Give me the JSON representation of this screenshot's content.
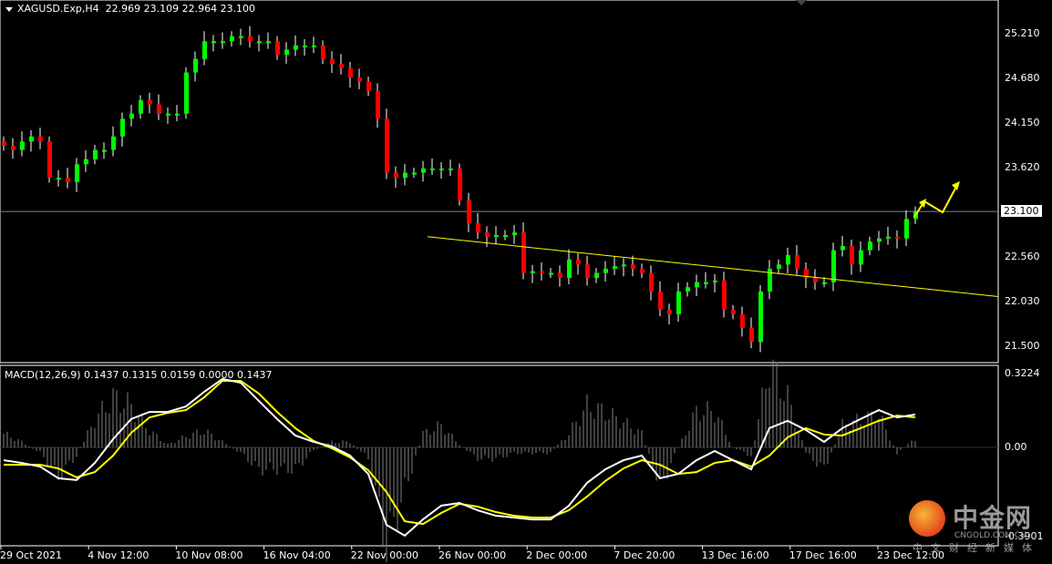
{
  "header": {
    "symbol": "XAGUSD.Exp,H4",
    "ohlc": "22.969 23.109 22.964 23.100"
  },
  "macd_header": "MACD(12,26,9) 0.1437 0.1315 0.0159 0.0000 0.1437",
  "watermark": {
    "name": "中金网",
    "domain": "CNGOLD.COM.CN",
    "slogan": "中文财经新媒体"
  },
  "colors": {
    "background": "#000000",
    "bull": "#00ff00",
    "bear": "#ff0000",
    "wick": "#ffffff",
    "macd_main": "#ffffff",
    "macd_signal": "#ffff00",
    "histogram": "#808080",
    "trendline": "#ffff00",
    "price_line": "#778899",
    "arrows": "#ffff00"
  },
  "chart_data": [
    {
      "type": "candlestick",
      "title": "XAGUSD.Exp,H4",
      "y_ticks": [
        "25.210",
        "24.680",
        "24.150",
        "23.620",
        "22.560",
        "22.030",
        "21.500"
      ],
      "current_price": "23.100",
      "ylim": [
        21.45,
        25.6
      ],
      "x_ticks": [
        "29 Oct 2021",
        "4 Nov 12:00",
        "10 Nov 08:00",
        "16 Nov 04:00",
        "22 Nov 00:00",
        "26 Nov 00:00",
        "2 Dec 00:00",
        "7 Dec 20:00",
        "13 Dec 16:00",
        "17 Dec 16:00",
        "23 Dec 12:00"
      ],
      "close": [
        23.88,
        23.83,
        23.93,
        23.99,
        23.93,
        23.5,
        23.5,
        23.45,
        23.66,
        23.72,
        23.83,
        23.83,
        23.99,
        24.2,
        24.26,
        24.42,
        24.37,
        24.26,
        24.26,
        24.26,
        24.75,
        24.91,
        25.12,
        25.12,
        25.12,
        25.18,
        25.18,
        25.12,
        25.12,
        25.12,
        24.96,
        25.02,
        25.07,
        25.07,
        25.07,
        24.91,
        24.85,
        24.8,
        24.69,
        24.64,
        24.53,
        24.2,
        23.56,
        23.5,
        23.56,
        23.56,
        23.61,
        23.61,
        23.61,
        23.61,
        23.23,
        22.96,
        22.85,
        22.8,
        22.82,
        22.82,
        22.85,
        22.37,
        22.39,
        22.37,
        22.37,
        22.31,
        22.53,
        22.47,
        22.31,
        22.37,
        22.42,
        22.45,
        22.47,
        22.42,
        22.37,
        22.15,
        21.93,
        21.88,
        22.15,
        22.2,
        22.26,
        22.26,
        22.28,
        21.93,
        21.88,
        21.72,
        21.55,
        22.15,
        22.42,
        22.47,
        22.58,
        22.42,
        22.31,
        22.26,
        22.26,
        22.64,
        22.69,
        22.47,
        22.64,
        22.74,
        22.78,
        22.8,
        22.78,
        23.01,
        23.1
      ],
      "trendline": {
        "start_price": 22.8,
        "end_price": 22.09
      }
    },
    {
      "type": "line",
      "title": "MACD(12,26,9)",
      "y_ticks": [
        "0.3224",
        "0.00",
        "-0.3901"
      ],
      "ylim": [
        -0.43,
        0.36
      ],
      "series": [
        {
          "name": "MACD",
          "values": [
            -0.056,
            -0.068,
            -0.084,
            -0.135,
            -0.143,
            -0.068,
            0.036,
            0.124,
            0.155,
            0.155,
            0.179,
            0.243,
            0.299,
            0.283,
            0.203,
            0.124,
            0.052,
            0.024,
            0.004,
            -0.036,
            -0.116,
            -0.339,
            -0.386,
            -0.315,
            -0.255,
            -0.243,
            -0.275,
            -0.299,
            -0.307,
            -0.315,
            -0.315,
            -0.255,
            -0.155,
            -0.096,
            -0.056,
            -0.036,
            -0.135,
            -0.116,
            -0.056,
            -0.016,
            -0.056,
            -0.096,
            0.084,
            0.116,
            0.076,
            0.024,
            0.084,
            0.124,
            0.163,
            0.131,
            0.1437
          ]
        },
        {
          "name": "Signal",
          "values": [
            -0.076,
            -0.076,
            -0.076,
            -0.092,
            -0.131,
            -0.108,
            -0.036,
            0.064,
            0.131,
            0.151,
            0.163,
            0.219,
            0.291,
            0.291,
            0.235,
            0.155,
            0.084,
            0.028,
            -0.004,
            -0.044,
            -0.1,
            -0.195,
            -0.323,
            -0.335,
            -0.287,
            -0.247,
            -0.259,
            -0.283,
            -0.299,
            -0.307,
            -0.307,
            -0.275,
            -0.215,
            -0.147,
            -0.092,
            -0.056,
            -0.076,
            -0.116,
            -0.108,
            -0.068,
            -0.056,
            -0.084,
            -0.036,
            0.044,
            0.084,
            0.056,
            0.052,
            0.084,
            0.116,
            0.139,
            0.1315
          ]
        }
      ]
    }
  ]
}
